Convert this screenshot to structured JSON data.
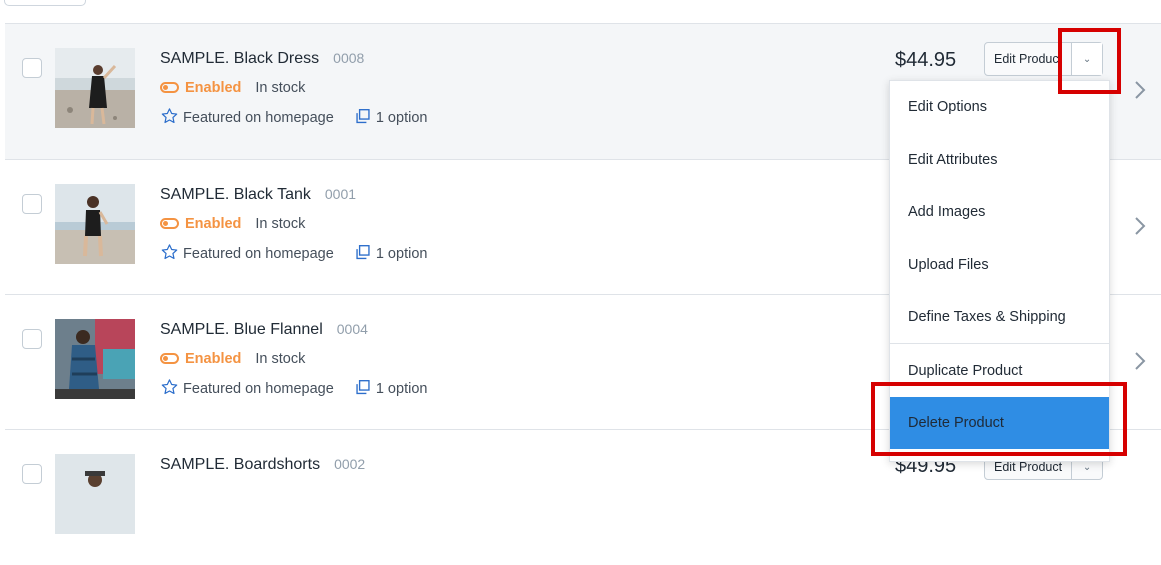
{
  "products": [
    {
      "name": "SAMPLE. Black Dress",
      "sku": "0008",
      "status": "Enabled",
      "stock": "In stock",
      "featured": "Featured on homepage",
      "options": "1 option",
      "price": "$44.95",
      "edit_label": "Edit Product"
    },
    {
      "name": "SAMPLE. Black Tank",
      "sku": "0001",
      "status": "Enabled",
      "stock": "In stock",
      "featured": "Featured on homepage",
      "options": "1 option"
    },
    {
      "name": "SAMPLE. Blue Flannel",
      "sku": "0004",
      "status": "Enabled",
      "stock": "In stock",
      "featured": "Featured on homepage",
      "options": "1 option"
    },
    {
      "name": "SAMPLE. Boardshorts",
      "sku": "0002",
      "price": "$49.95",
      "edit_label": "Edit Product"
    }
  ],
  "dropdown": {
    "items": [
      "Edit Options",
      "Edit Attributes",
      "Add Images",
      "Upload Files",
      "Define Taxes & Shipping",
      "Duplicate Product",
      "Delete Product"
    ]
  },
  "colors": {
    "enabled": "#f49342",
    "delete_highlight": "#2f8de4",
    "annotation": "#d60000",
    "featured_icon": "#2c6ecb"
  }
}
